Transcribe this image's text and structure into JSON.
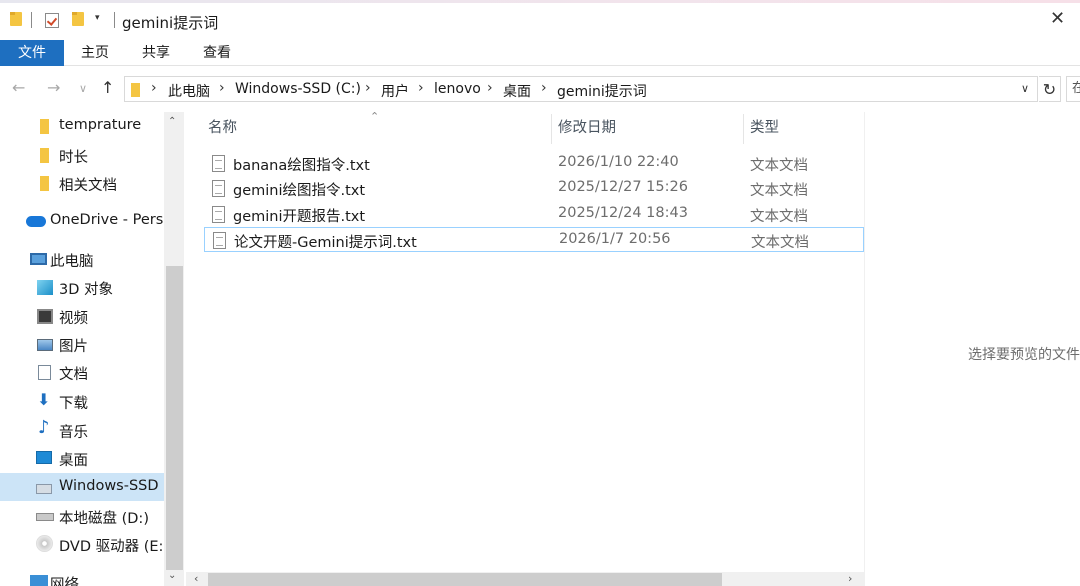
{
  "window": {
    "title": "gemini提示词",
    "close_glyph": "✕",
    "dropdown_glyph": "▾"
  },
  "ribbon": {
    "tabs": [
      "文件",
      "主页",
      "共享",
      "查看"
    ]
  },
  "address": {
    "crumbs": [
      "此电脑",
      "Windows-SSD (C:)",
      "用户",
      "lenovo",
      "桌面",
      "gemini提示词"
    ],
    "separator": "›",
    "dropdown_glyph": "∨",
    "refresh_glyph": "↻",
    "search_placeholder": "在"
  },
  "nav_buttons": {
    "back": "←",
    "forward": "→",
    "recent": "∨",
    "up": "↑"
  },
  "navigation": {
    "items": [
      {
        "label": "temprature",
        "icon": "folder-icon"
      },
      {
        "label": "时长",
        "icon": "folder-icon"
      },
      {
        "label": "相关文档",
        "icon": "folder-icon"
      },
      {
        "label": "OneDrive - Personal",
        "icon": "onedrive-cloud-icon"
      },
      {
        "label": "此电脑",
        "icon": "this-pc-icon"
      },
      {
        "label": "3D 对象",
        "icon": "3d-objects-icon"
      },
      {
        "label": "视频",
        "icon": "videos-icon"
      },
      {
        "label": "图片",
        "icon": "pictures-icon"
      },
      {
        "label": "文档",
        "icon": "documents-icon"
      },
      {
        "label": "下载",
        "icon": "downloads-icon"
      },
      {
        "label": "音乐",
        "icon": "music-icon"
      },
      {
        "label": "桌面",
        "icon": "desktop-icon"
      },
      {
        "label": "Windows-SSD (C:)",
        "icon": "ssd-drive-icon"
      },
      {
        "label": "本地磁盘 (D:)",
        "icon": "hard-drive-icon"
      },
      {
        "label": "DVD 驱动器 (E:)",
        "icon": "dvd-drive-icon"
      },
      {
        "label": "网络",
        "icon": "network-icon"
      }
    ],
    "selected_label": "Windows-SSD (C:)",
    "scroll_up_glyph": "⌃",
    "scroll_down_glyph": "⌄"
  },
  "filelist": {
    "columns": [
      "名称",
      "修改日期",
      "类型"
    ],
    "sort_glyph": "⌃",
    "rows": [
      {
        "name": "banana绘图指令.txt",
        "modified": "2026/1/10 22:40",
        "type": "文本文档"
      },
      {
        "name": "gemini绘图指令.txt",
        "modified": "2025/12/27 15:26",
        "type": "文本文档"
      },
      {
        "name": "gemini开题报告.txt",
        "modified": "2025/12/24 18:43",
        "type": "文本文档"
      },
      {
        "name": "论文开题-Gemini提示词.txt",
        "modified": "2026/1/7 20:56",
        "type": "文本文档"
      }
    ],
    "focused_row": "论文开题-Gemini提示词.txt",
    "scroll_left_glyph": "‹",
    "scroll_right_glyph": "›"
  },
  "preview": {
    "text": "选择要预览的文件"
  },
  "colors": {
    "accent": "#1e6fc0",
    "selection": "#cce4f7",
    "focus_border": "#99d1ff"
  }
}
